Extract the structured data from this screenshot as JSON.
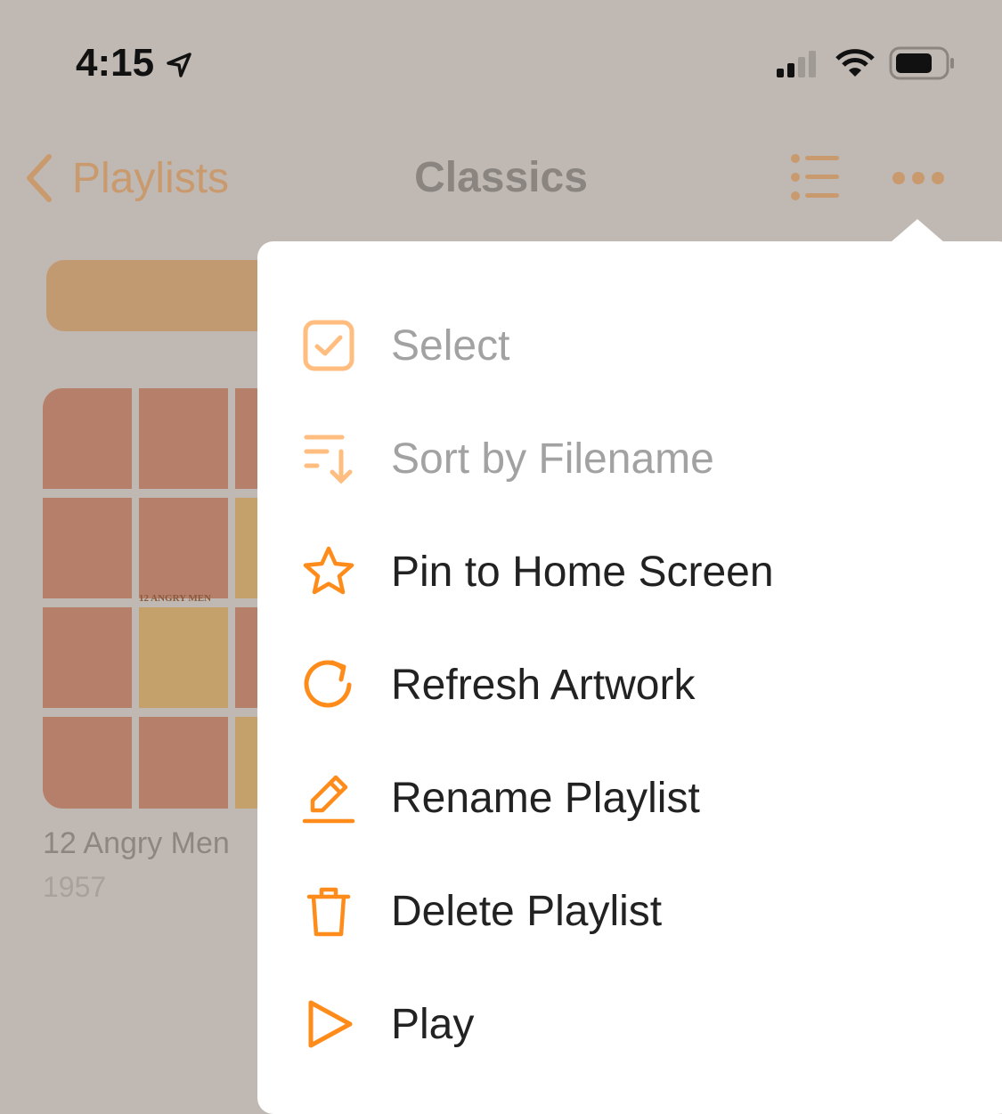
{
  "status": {
    "time": "4:15"
  },
  "nav": {
    "back_label": "Playlists",
    "title": "Classics"
  },
  "album": {
    "title": "12 Angry Men",
    "year": "1957",
    "poster_text": "12 ANGRY MEN"
  },
  "menu": {
    "items": [
      {
        "label": "Select",
        "icon": "checkbox-icon",
        "enabled": false
      },
      {
        "label": "Sort by Filename",
        "icon": "sort-icon",
        "enabled": false
      },
      {
        "label": "Pin to Home Screen",
        "icon": "star-icon",
        "enabled": true
      },
      {
        "label": "Refresh Artwork",
        "icon": "refresh-icon",
        "enabled": true
      },
      {
        "label": "Rename Playlist",
        "icon": "pencil-icon",
        "enabled": true
      },
      {
        "label": "Delete Playlist",
        "icon": "trash-icon",
        "enabled": true
      },
      {
        "label": "Play",
        "icon": "play-icon",
        "enabled": true
      }
    ]
  },
  "colors": {
    "accent": "#ff8c1a",
    "accent_disabled": "#ffbd80"
  }
}
